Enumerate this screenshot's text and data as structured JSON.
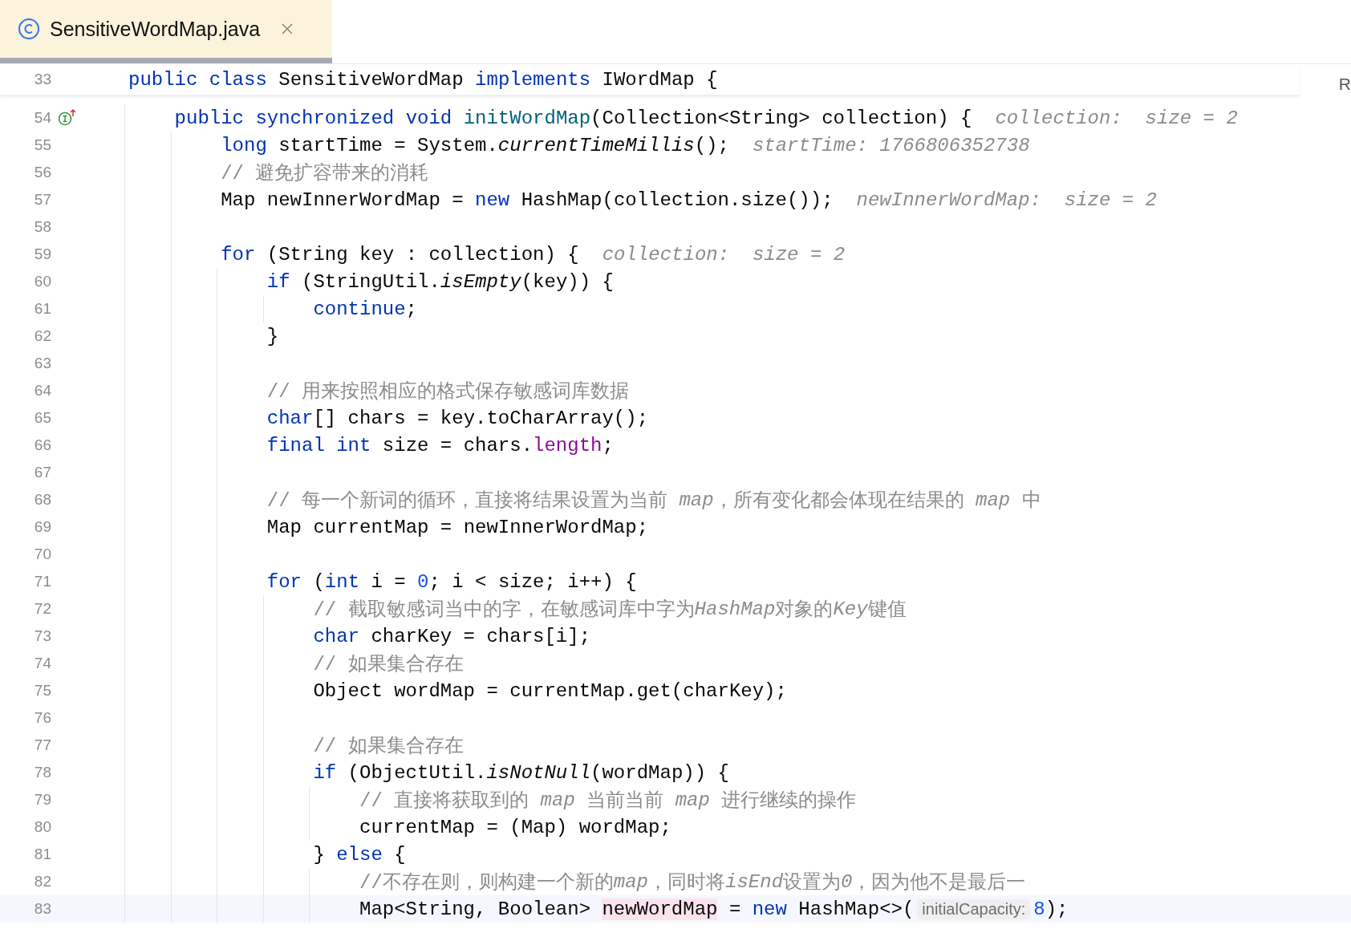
{
  "tabs": [
    {
      "title": "SensitiveWordMap.java",
      "selected": true
    }
  ],
  "sticky_line": {
    "number": "33",
    "tokens": [
      {
        "kind": "keyword",
        "text": "public class"
      },
      {
        "kind": "plain",
        "text": " SensitiveWordMap "
      },
      {
        "kind": "keyword",
        "text": "implements"
      },
      {
        "kind": "plain",
        "text": " IWordMap {"
      }
    ]
  },
  "right_edge_text": "R",
  "lines": [
    {
      "number": "54",
      "current": false,
      "gutter_marker": true,
      "tokens": [
        {
          "kind": "keyword",
          "text": "    public synchronized void "
        },
        {
          "kind": "method",
          "text": "initWordMap"
        },
        {
          "kind": "plain",
          "text": "(Collection<String> collection) {"
        },
        {
          "kind": "debug_hint",
          "text": "collection:  size = 2"
        }
      ]
    },
    {
      "number": "55",
      "current": false,
      "gutter_marker": false,
      "tokens": [
        {
          "kind": "keyword",
          "text": "        long"
        },
        {
          "kind": "plain",
          "text": " startTime = System."
        },
        {
          "kind": "static_call",
          "text": "currentTimeMillis"
        },
        {
          "kind": "plain",
          "text": "();"
        },
        {
          "kind": "debug_hint",
          "text": "startTime: 1766806352738"
        }
      ]
    },
    {
      "number": "56",
      "current": false,
      "gutter_marker": false,
      "tokens": [
        {
          "kind": "comment",
          "text": "        // 避免扩容带来的消耗"
        }
      ]
    },
    {
      "number": "57",
      "current": false,
      "gutter_marker": false,
      "tokens": [
        {
          "kind": "plain",
          "text": "        Map newInnerWordMap = "
        },
        {
          "kind": "keyword",
          "text": "new"
        },
        {
          "kind": "plain",
          "text": " HashMap(collection.size());"
        },
        {
          "kind": "debug_hint",
          "text": "newInnerWordMap:  size = 2"
        }
      ]
    },
    {
      "number": "58",
      "current": false,
      "gutter_marker": false
    },
    {
      "number": "59",
      "current": false,
      "gutter_marker": false,
      "tokens": [
        {
          "kind": "keyword",
          "text": "        for"
        },
        {
          "kind": "plain",
          "text": " (String key : collection) {"
        },
        {
          "kind": "debug_hint",
          "text": "collection:  size = 2"
        }
      ]
    },
    {
      "number": "60",
      "current": false,
      "gutter_marker": false,
      "tokens": [
        {
          "kind": "keyword",
          "text": "            if"
        },
        {
          "kind": "plain",
          "text": " (StringUtil."
        },
        {
          "kind": "static_call",
          "text": "isEmpty"
        },
        {
          "kind": "plain",
          "text": "(key)) {"
        }
      ]
    },
    {
      "number": "61",
      "current": false,
      "gutter_marker": false,
      "tokens": [
        {
          "kind": "keyword",
          "text": "                continue"
        },
        {
          "kind": "plain",
          "text": ";"
        }
      ]
    },
    {
      "number": "62",
      "current": false,
      "gutter_marker": false,
      "tokens": [
        {
          "kind": "plain",
          "text": "            }"
        }
      ]
    },
    {
      "number": "63",
      "current": false,
      "gutter_marker": false
    },
    {
      "number": "64",
      "current": false,
      "gutter_marker": false,
      "tokens": [
        {
          "kind": "comment",
          "text": "            // 用来按照相应的格式保存敏感词库数据"
        }
      ]
    },
    {
      "number": "65",
      "current": false,
      "gutter_marker": false,
      "tokens": [
        {
          "kind": "keyword",
          "text": "            char"
        },
        {
          "kind": "plain",
          "text": "[] chars = key.toCharArray();"
        }
      ]
    },
    {
      "number": "66",
      "current": false,
      "gutter_marker": false,
      "tokens": [
        {
          "kind": "keyword",
          "text": "            final int"
        },
        {
          "kind": "plain",
          "text": " size = chars."
        },
        {
          "kind": "field",
          "text": "length"
        },
        {
          "kind": "plain",
          "text": ";"
        }
      ]
    },
    {
      "number": "67",
      "current": false,
      "gutter_marker": false
    },
    {
      "number": "68",
      "current": false,
      "gutter_marker": false,
      "tokens": [
        {
          "kind": "comment",
          "text": "            // 每一个新词的循环，直接将结果设置为当前 "
        },
        {
          "kind": "comment_italic",
          "text": "map"
        },
        {
          "kind": "comment",
          "text": "，所有变化都会体现在结果的 "
        },
        {
          "kind": "comment_italic",
          "text": "map"
        },
        {
          "kind": "comment",
          "text": " 中"
        }
      ]
    },
    {
      "number": "69",
      "current": false,
      "gutter_marker": false,
      "tokens": [
        {
          "kind": "plain",
          "text": "            Map currentMap = newInnerWordMap;"
        }
      ]
    },
    {
      "number": "70",
      "current": false,
      "gutter_marker": false
    },
    {
      "number": "71",
      "current": false,
      "gutter_marker": false,
      "tokens": [
        {
          "kind": "keyword",
          "text": "            for"
        },
        {
          "kind": "plain",
          "text": " ("
        },
        {
          "kind": "keyword",
          "text": "int"
        },
        {
          "kind": "plain",
          "text": " i = "
        },
        {
          "kind": "number",
          "text": "0"
        },
        {
          "kind": "plain",
          "text": "; i < size; i++) {"
        }
      ]
    },
    {
      "number": "72",
      "current": false,
      "gutter_marker": false,
      "tokens": [
        {
          "kind": "comment",
          "text": "                // 截取敏感词当中的字，在敏感词库中字为"
        },
        {
          "kind": "comment_italic",
          "text": "HashMap"
        },
        {
          "kind": "comment",
          "text": "对象的"
        },
        {
          "kind": "comment_italic",
          "text": "Key"
        },
        {
          "kind": "comment",
          "text": "键值"
        }
      ]
    },
    {
      "number": "73",
      "current": false,
      "gutter_marker": false,
      "tokens": [
        {
          "kind": "keyword",
          "text": "                char"
        },
        {
          "kind": "plain",
          "text": " charKey = chars[i];"
        }
      ]
    },
    {
      "number": "74",
      "current": false,
      "gutter_marker": false,
      "tokens": [
        {
          "kind": "comment",
          "text": "                // 如果集合存在"
        }
      ]
    },
    {
      "number": "75",
      "current": false,
      "gutter_marker": false,
      "tokens": [
        {
          "kind": "plain",
          "text": "                Object wordMap = currentMap.get(charKey);"
        }
      ]
    },
    {
      "number": "76",
      "current": false,
      "gutter_marker": false
    },
    {
      "number": "77",
      "current": false,
      "gutter_marker": false,
      "tokens": [
        {
          "kind": "comment",
          "text": "                // 如果集合存在"
        }
      ]
    },
    {
      "number": "78",
      "current": false,
      "gutter_marker": false,
      "tokens": [
        {
          "kind": "keyword",
          "text": "                if"
        },
        {
          "kind": "plain",
          "text": " (ObjectUtil."
        },
        {
          "kind": "static_call",
          "text": "isNotNull"
        },
        {
          "kind": "plain",
          "text": "(wordMap)) {"
        }
      ]
    },
    {
      "number": "79",
      "current": false,
      "gutter_marker": false,
      "tokens": [
        {
          "kind": "comment",
          "text": "                    // 直接将获取到的 "
        },
        {
          "kind": "comment_italic",
          "text": "map"
        },
        {
          "kind": "comment",
          "text": " 当前当前 "
        },
        {
          "kind": "comment_italic",
          "text": "map"
        },
        {
          "kind": "comment",
          "text": " 进行继续的操作"
        }
      ]
    },
    {
      "number": "80",
      "current": false,
      "gutter_marker": false,
      "tokens": [
        {
          "kind": "plain",
          "text": "                    currentMap = (Map) wordMap;"
        }
      ]
    },
    {
      "number": "81",
      "current": false,
      "gutter_marker": false,
      "tokens": [
        {
          "kind": "plain",
          "text": "                } "
        },
        {
          "kind": "keyword",
          "text": "else"
        },
        {
          "kind": "plain",
          "text": " {"
        }
      ]
    },
    {
      "number": "82",
      "current": false,
      "gutter_marker": false,
      "tokens": [
        {
          "kind": "comment",
          "text": "                    //不存在则，则构建一个新的"
        },
        {
          "kind": "comment_italic",
          "text": "map"
        },
        {
          "kind": "comment",
          "text": "，同时将"
        },
        {
          "kind": "comment_italic",
          "text": "isEnd"
        },
        {
          "kind": "comment",
          "text": "设置为"
        },
        {
          "kind": "comment_italic",
          "text": "0"
        },
        {
          "kind": "comment",
          "text": "，因为他不是最后一"
        }
      ]
    },
    {
      "number": "83",
      "current": true,
      "gutter_marker": false,
      "tokens": [
        {
          "kind": "plain",
          "text": "                    Map<String, Boolean> "
        },
        {
          "kind": "usage",
          "text": "newWordMap"
        },
        {
          "kind": "plain",
          "text": " = "
        },
        {
          "kind": "keyword",
          "text": "new"
        },
        {
          "kind": "plain",
          "text": " HashMap<>("
        },
        {
          "kind": "param_hint",
          "text": "initialCapacity:"
        },
        {
          "kind": "number",
          "text": "8"
        },
        {
          "kind": "plain",
          "text": ");"
        }
      ]
    }
  ]
}
